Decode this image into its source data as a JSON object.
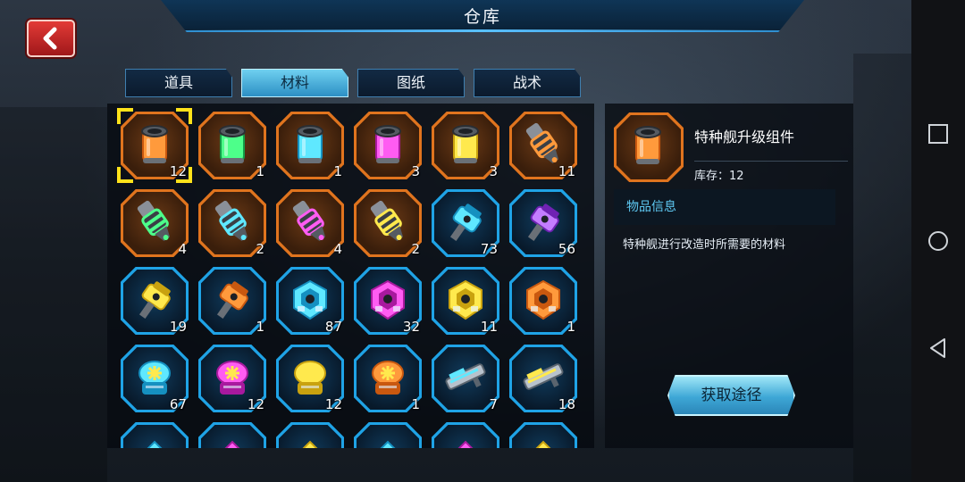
{
  "title": "仓库",
  "back_icon": "chevron-left-icon",
  "tabs": [
    {
      "label": "道具",
      "active": false
    },
    {
      "label": "材料",
      "active": true
    },
    {
      "label": "图纸",
      "active": false
    },
    {
      "label": "战术",
      "active": false
    }
  ],
  "items": [
    {
      "count": "12",
      "rarity": "orange",
      "icon": "canister-orange",
      "selected": true
    },
    {
      "count": "1",
      "rarity": "orange",
      "icon": "canister-green"
    },
    {
      "count": "1",
      "rarity": "orange",
      "icon": "canister-cyan"
    },
    {
      "count": "3",
      "rarity": "orange",
      "icon": "canister-magenta"
    },
    {
      "count": "3",
      "rarity": "orange",
      "icon": "canister-yellow"
    },
    {
      "count": "11",
      "rarity": "orange",
      "icon": "thruster-orange"
    },
    {
      "count": "4",
      "rarity": "orange",
      "icon": "thruster-green"
    },
    {
      "count": "2",
      "rarity": "orange",
      "icon": "thruster-cyan"
    },
    {
      "count": "4",
      "rarity": "orange",
      "icon": "thruster-magenta"
    },
    {
      "count": "2",
      "rarity": "orange",
      "icon": "thruster-yellow"
    },
    {
      "count": "73",
      "rarity": "blue",
      "icon": "cannon-cyan"
    },
    {
      "count": "56",
      "rarity": "blue",
      "icon": "cannon-purple"
    },
    {
      "count": "19",
      "rarity": "blue",
      "icon": "cannon-yellow"
    },
    {
      "count": "1",
      "rarity": "blue",
      "icon": "cannon-orange"
    },
    {
      "count": "87",
      "rarity": "blue",
      "icon": "armor-cyan"
    },
    {
      "count": "32",
      "rarity": "blue",
      "icon": "armor-magenta"
    },
    {
      "count": "11",
      "rarity": "blue",
      "icon": "armor-yellow"
    },
    {
      "count": "1",
      "rarity": "blue",
      "icon": "armor-orange"
    },
    {
      "count": "67",
      "rarity": "blue",
      "icon": "core-cyan"
    },
    {
      "count": "12",
      "rarity": "blue",
      "icon": "core-magenta"
    },
    {
      "count": "12",
      "rarity": "blue",
      "icon": "core-yellow"
    },
    {
      "count": "1",
      "rarity": "blue",
      "icon": "core-orange"
    },
    {
      "count": "7",
      "rarity": "blue",
      "icon": "railgun-cyan"
    },
    {
      "count": "18",
      "rarity": "blue",
      "icon": "railgun-yellow"
    },
    {
      "count": "",
      "rarity": "blue",
      "icon": "module-cyan"
    },
    {
      "count": "",
      "rarity": "blue",
      "icon": "module-magenta"
    },
    {
      "count": "",
      "rarity": "blue",
      "icon": "module-yellow"
    },
    {
      "count": "",
      "rarity": "blue",
      "icon": "module-cyan"
    },
    {
      "count": "",
      "rarity": "blue",
      "icon": "module-magenta"
    },
    {
      "count": "",
      "rarity": "blue",
      "icon": "module-yellow"
    }
  ],
  "detail": {
    "name": "特种舰升级组件",
    "stock_label": "库存：12",
    "info_header": "物品信息",
    "description": "特种舰进行改造时所需要的材料",
    "acquire_button": "获取途径",
    "icon": "canister-orange"
  },
  "system_nav": [
    "recent-apps-icon",
    "home-icon",
    "back-triangle-icon"
  ],
  "colors": {
    "accent_blue": "#1fa3e6",
    "rarity_orange": "#e0741e",
    "tab_active": "#4fb9e3",
    "back_red": "#d22a2a"
  }
}
